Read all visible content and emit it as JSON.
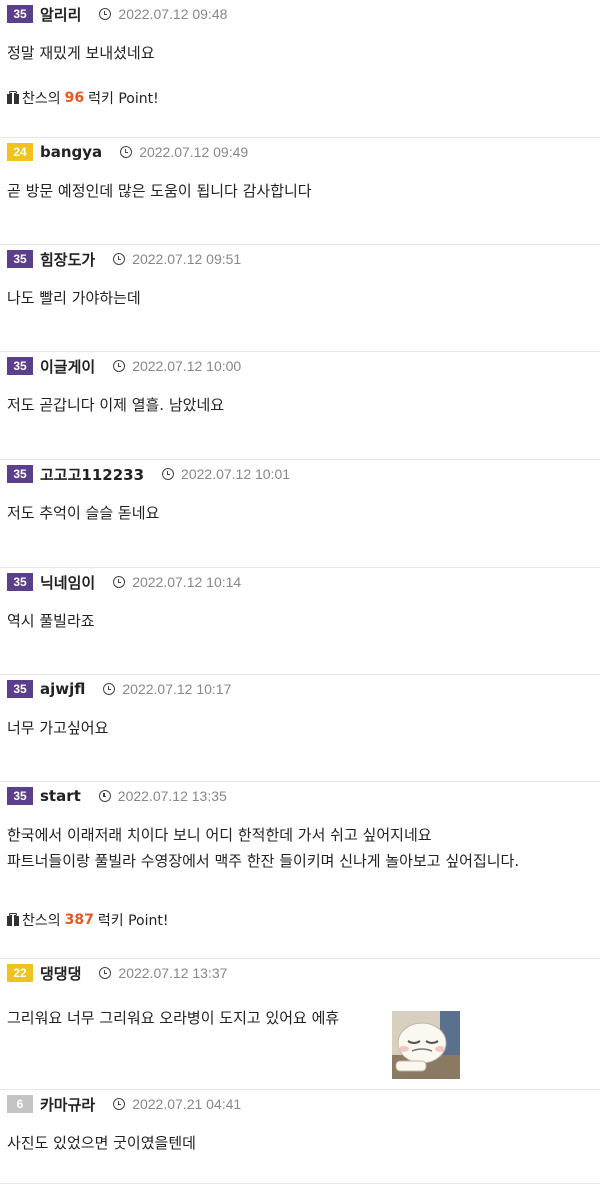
{
  "badge_colors": {
    "purple": "#5b3e8c",
    "yellow": "#efc31c",
    "gray": "#c4c4c4"
  },
  "accent": "#e8571f",
  "icons": {
    "clock": "clock-icon",
    "gift": "gift-icon"
  },
  "comments": [
    {
      "level": "35",
      "level_color": "purple",
      "nick": "알리리",
      "date": "2022.07.12 09:48",
      "lines": [
        "정말 재밌게 보내셨네요"
      ],
      "lucky": {
        "prefix": "찬스의",
        "number": "96",
        "suffix": "럭키 Point!"
      }
    },
    {
      "level": "24",
      "level_color": "yellow",
      "nick": "bangya",
      "date": "2022.07.12 09:49",
      "lines": [
        "곧 방문 예정인데 많은 도움이 됩니다 감사합니다"
      ]
    },
    {
      "level": "35",
      "level_color": "purple",
      "nick": "힘장도가",
      "date": "2022.07.12 09:51",
      "lines": [
        "나도 빨리 가야하는데"
      ]
    },
    {
      "level": "35",
      "level_color": "purple",
      "nick": "이글게이",
      "date": "2022.07.12 10:00",
      "lines": [
        "저도 곧갑니다 이제 열흘. 남았네요"
      ]
    },
    {
      "level": "35",
      "level_color": "purple",
      "nick": "고고고112233",
      "date": "2022.07.12 10:01",
      "lines": [
        "저도 추억이 슬슬 돋네요"
      ]
    },
    {
      "level": "35",
      "level_color": "purple",
      "nick": "닉네임이",
      "date": "2022.07.12 10:14",
      "lines": [
        "역시 풀빌라죠"
      ]
    },
    {
      "level": "35",
      "level_color": "purple",
      "nick": "ajwjfl",
      "date": "2022.07.12 10:17",
      "lines": [
        "너무 가고싶어요"
      ]
    },
    {
      "level": "35",
      "level_color": "purple",
      "nick": "start",
      "date": "2022.07.12 13:35",
      "lines": [
        "한국에서 이래저래 치이다 보니 어디 한적한데 가서 쉬고 싶어지네요",
        "파트너들이랑 풀빌라 수영장에서 맥주 한잔 들이키며 신나게 놀아보고 싶어집니다."
      ],
      "lucky": {
        "prefix": "찬스의",
        "number": "387",
        "suffix": "럭키 Point!"
      }
    },
    {
      "level": "22",
      "level_color": "yellow",
      "nick": "댕댕댕",
      "date": "2022.07.12 13:37",
      "lines": [
        "그리워요 너무 그리워요 오라병이 도지고 있어요 에휴"
      ],
      "emoticon": "crying-emoticon"
    },
    {
      "level": "6",
      "level_color": "gray",
      "nick": "카마규라",
      "date": "2022.07.21 04:41",
      "lines": [
        "사진도 있었으면 굿이였을텐데"
      ]
    }
  ]
}
